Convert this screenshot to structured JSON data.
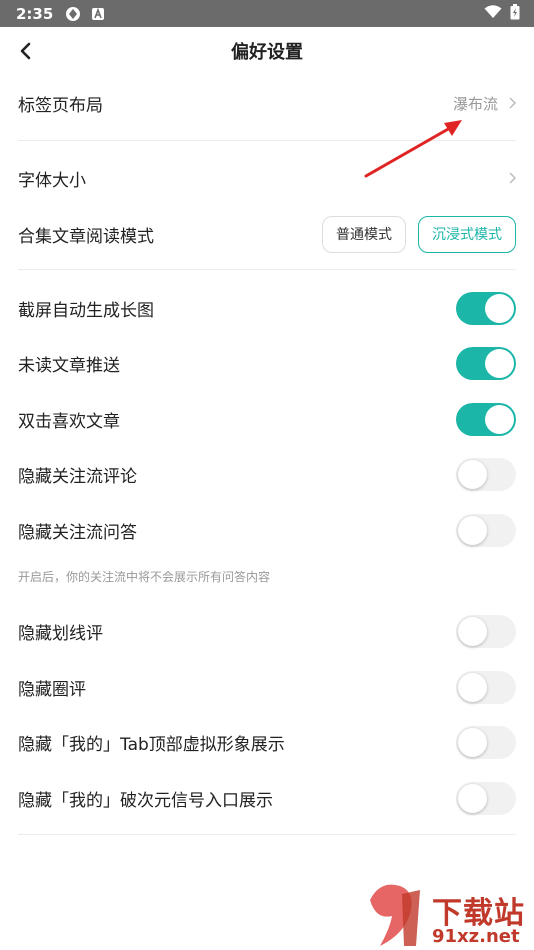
{
  "status": {
    "time": "2:35"
  },
  "nav": {
    "title": "偏好设置"
  },
  "tab_layout": {
    "label": "标签页布局",
    "value": "瀑布流"
  },
  "font_size": {
    "label": "字体大小"
  },
  "reading_mode": {
    "label": "合集文章阅读模式",
    "option_normal": "普通模式",
    "option_immersive": "沉浸式模式",
    "selected": "沉浸式模式"
  },
  "toggles": [
    {
      "label": "截屏自动生成长图",
      "on": true
    },
    {
      "label": "未读文章推送",
      "on": true
    },
    {
      "label": "双击喜欢文章",
      "on": true
    },
    {
      "label": "隐藏关注流评论",
      "on": false
    },
    {
      "label": "隐藏关注流问答",
      "on": false
    },
    {
      "label": "隐藏划线评",
      "on": false
    },
    {
      "label": "隐藏圈评",
      "on": false
    },
    {
      "label": "隐藏「我的」Tab顶部虚拟形象展示",
      "on": false
    },
    {
      "label": "隐藏「我的」破次元信号入口展示",
      "on": false
    }
  ],
  "hint": "开启后，你的关注流中将不会展示所有问答内容",
  "watermark": {
    "brand": "下载站",
    "url": "91xz.net"
  },
  "colors": {
    "accent": "#1bb6a8",
    "statusbar": "#6b6b6b",
    "arrow": "#e02424"
  }
}
